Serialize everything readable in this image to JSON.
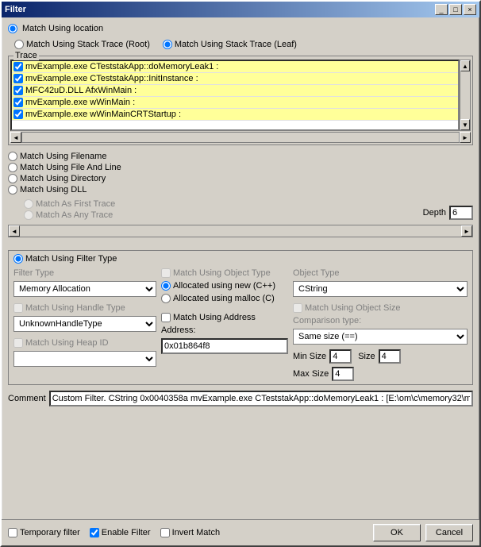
{
  "window": {
    "title": "Filter",
    "close_label": "×",
    "minimize_label": "_",
    "maximize_label": "□"
  },
  "top_radios": {
    "match_location_label": "Match Using location",
    "match_stack_root_label": "Match Using Stack Trace (Root)",
    "match_stack_leaf_label": "Match Using Stack Trace (Leaf)"
  },
  "trace": {
    "group_label": "Trace",
    "items": [
      {
        "text": "mvExample.exe CTeststakApp::doMemoryLeak1 :"
      },
      {
        "text": "mvExample.exe CTeststakApp::InitInstance :"
      },
      {
        "text": "MFC42uD.DLL AfxWinMain :"
      },
      {
        "text": "mvExample.exe wWinMain :"
      },
      {
        "text": "mvExample.exe wWinMainCRTStartup :"
      }
    ]
  },
  "match_options": {
    "filename_label": "Match Using Filename",
    "file_and_line_label": "Match Using File And Line",
    "directory_label": "Match Using Directory",
    "dll_label": "Match Using DLL",
    "first_trace_label": "Match As First Trace",
    "any_trace_label": "Match As Any Trace",
    "depth_label": "Depth",
    "depth_value": "6"
  },
  "bottom_section": {
    "match_filter_type_label": "Match Using Filter Type",
    "filter_type_label": "Filter Type",
    "filter_type_value": "Memory Allocation",
    "match_handle_type_label": "Match Using Handle Type",
    "handle_type_value": "UnknownHandleType",
    "match_heap_id_label": "Match Using Heap ID",
    "heap_id_value": "",
    "match_object_type_label": "Match Using Object Type",
    "alloc_new_label": "Allocated using new (C++)",
    "alloc_malloc_label": "Allocated using malloc (C)",
    "match_address_label": "Match Using Address",
    "address_label": "Address:",
    "address_value": "0x01b864f8",
    "object_type_label": "Object Type",
    "object_type_value": "CString",
    "match_object_size_label": "Match Using Object Size",
    "comparison_type_label": "Comparison type:",
    "comparison_type_value": "Same size (==)",
    "min_size_label": "Min Size",
    "min_size_value": "4",
    "size_label": "Size",
    "size_value": "4",
    "max_size_label": "Max Size",
    "max_size_value": "4"
  },
  "comment": {
    "label": "Comment",
    "value": "Custom Filter. CString 0x0040358a mvExample.exe CTeststakApp::doMemoryLeak1 : [E:\\om\\c\\memory32\\m"
  },
  "bottom_bar": {
    "temp_filter_label": "Temporary filter",
    "enable_filter_label": "Enable Filter",
    "invert_match_label": "Invert Match",
    "ok_label": "OK",
    "cancel_label": "Cancel"
  }
}
